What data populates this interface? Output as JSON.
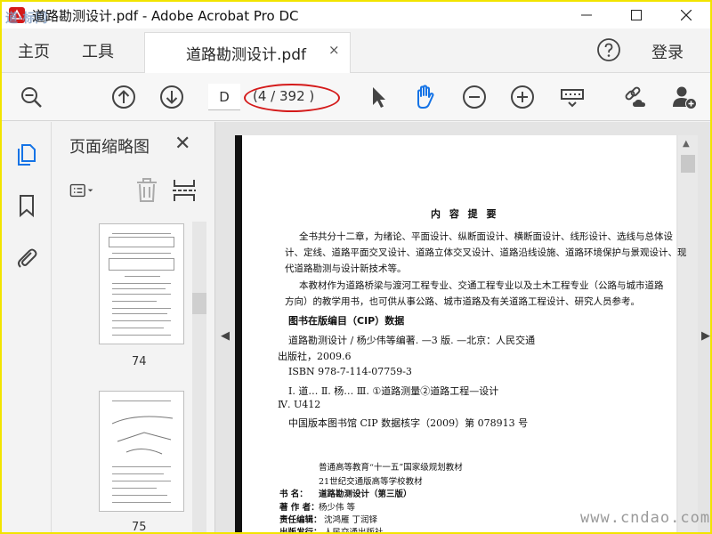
{
  "window": {
    "title": "道路勘测设计.pdf - Adobe Acrobat Pro DC"
  },
  "tabs": {
    "home": "主页",
    "tools": "工具",
    "document": "道路勘测设计.pdf",
    "close": "×",
    "login": "登录"
  },
  "toolbar": {
    "page_input": "D",
    "page_count": "(4 / 392 )"
  },
  "thumbnails": {
    "title": "页面缩略图",
    "close": "✕",
    "pages": [
      "74",
      "75"
    ]
  },
  "document": {
    "heading": "内 容 提 要",
    "summary": [
      "全书共分十二章，为绪论、平面设计、纵断面设计、横断面设计、线形设计、选线与总体设",
      "计、定线、道路平面交叉设计、道路立体交叉设计、道路沿线设施、道路环境保护与景观设计、现",
      "代道路勘测与设计新技术等。",
      "本教材作为道路桥梁与渡河工程专业、交通工程专业以及土木工程专业（公路与城市道路",
      "方向）的教学用书，也可供从事公路、城市道路及有关道路工程设计、研究人员参考。"
    ],
    "cip_title": "图书在版编目（CIP）数据",
    "cip_lines": [
      "道路勘测设计 / 杨少伟等编著. —3 版. —北京：人民交通",
      "出版社，2009.6",
      "ISBN 978-7-114-07759-3",
      "Ⅰ. 道…   Ⅱ. 杨…   Ⅲ. ①道路测量②道路工程—设计",
      "Ⅳ. U412",
      "中国版本图书馆 CIP 数据核字（2009）第 078913 号"
    ],
    "series": [
      "普通高等教育“十一五”国家级规划教材",
      "21世纪交通版高等学校教材"
    ],
    "meta": [
      {
        "label": "书    名：",
        "value": "道路勘测设计（第三版）"
      },
      {
        "label": "著 作 者：",
        "value": "杨少伟    等"
      },
      {
        "label": "责任编辑：",
        "value": "沈鸿雁    丁润铎"
      },
      {
        "label": "出版发行：",
        "value": "人民交通出版社"
      }
    ]
  },
  "watermark": {
    "site": "www.cndao.com",
    "logo": "道·标网"
  },
  "colors": {
    "highlight_ellipse": "#d41a1a",
    "accent_blue": "#1473e6",
    "frame": "#f2e400"
  },
  "icons": {
    "search": "search-icon",
    "prev_page": "arrow-up-circle-icon",
    "next_page": "arrow-down-circle-icon",
    "select": "cursor-icon",
    "hand": "hand-icon",
    "zoom_out": "minus-circle-icon",
    "zoom_in": "plus-circle-icon",
    "keyboard": "keyboard-icon",
    "share_link": "cloud-link-icon",
    "add_user": "add-user-icon",
    "help": "help-icon"
  }
}
